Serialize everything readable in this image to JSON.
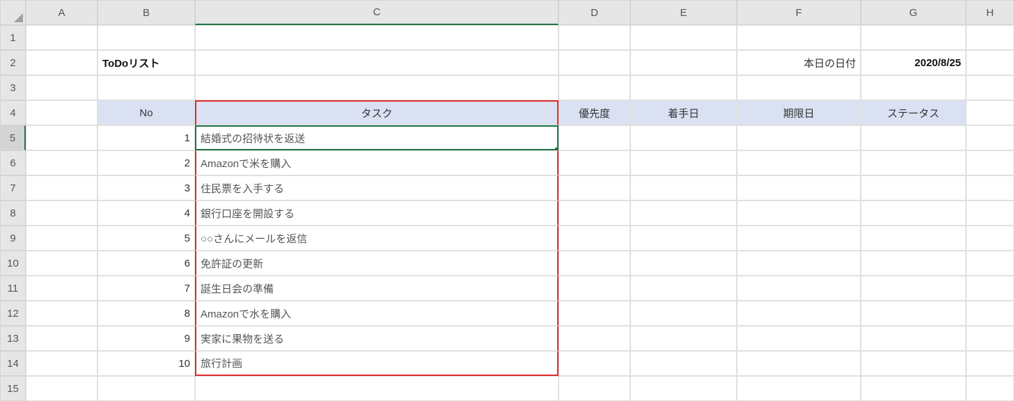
{
  "columns": [
    "A",
    "B",
    "C",
    "D",
    "E",
    "F",
    "G",
    "H"
  ],
  "rowCount": 15,
  "title": "ToDoリスト",
  "date_label": "本日の日付",
  "date_value": "2020/8/25",
  "headers": {
    "no": "No",
    "task": "タスク",
    "priority": "優先度",
    "start": "着手日",
    "due": "期限日",
    "status": "ステータス"
  },
  "tasks": [
    {
      "no": 1,
      "name": "結婚式の招待状を返送"
    },
    {
      "no": 2,
      "name": "Amazonで米を購入"
    },
    {
      "no": 3,
      "name": "住民票を入手する"
    },
    {
      "no": 4,
      "name": "銀行口座を開設する"
    },
    {
      "no": 5,
      "name": "○○さんにメールを返信"
    },
    {
      "no": 6,
      "name": "免許証の更新"
    },
    {
      "no": 7,
      "name": "誕生日会の準備"
    },
    {
      "no": 8,
      "name": "Amazonで水を購入"
    },
    {
      "no": 9,
      "name": "実家に果物を送る"
    },
    {
      "no": 10,
      "name": "旅行計画"
    }
  ],
  "chart_data": {
    "type": "table",
    "title": "ToDoリスト",
    "columns": [
      "No",
      "タスク",
      "優先度",
      "着手日",
      "期限日",
      "ステータス"
    ],
    "rows": [
      [
        1,
        "結婚式の招待状を返送",
        "",
        "",
        "",
        ""
      ],
      [
        2,
        "Amazonで米を購入",
        "",
        "",
        "",
        ""
      ],
      [
        3,
        "住民票を入手する",
        "",
        "",
        "",
        ""
      ],
      [
        4,
        "銀行口座を開設する",
        "",
        "",
        "",
        ""
      ],
      [
        5,
        "○○さんにメールを返信",
        "",
        "",
        "",
        ""
      ],
      [
        6,
        "免許証の更新",
        "",
        "",
        "",
        ""
      ],
      [
        7,
        "誕生日会の準備",
        "",
        "",
        "",
        ""
      ],
      [
        8,
        "Amazonで水を購入",
        "",
        "",
        "",
        ""
      ],
      [
        9,
        "実家に果物を送る",
        "",
        "",
        "",
        ""
      ],
      [
        10,
        "旅行計画",
        "",
        "",
        "",
        ""
      ]
    ]
  }
}
